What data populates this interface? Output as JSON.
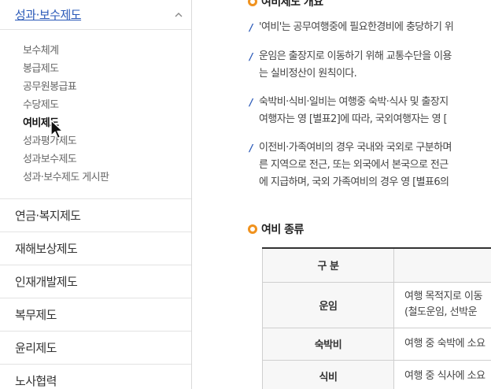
{
  "sidebar": {
    "title": "성과·보수제도",
    "sub_items": [
      {
        "label": "보수체계"
      },
      {
        "label": "봉급제도"
      },
      {
        "label": "공무원봉급표"
      },
      {
        "label": "수당제도"
      },
      {
        "label": "여비제도",
        "active": true
      },
      {
        "label": "성과평가제도"
      },
      {
        "label": "성과보수제도"
      },
      {
        "label": "성과·보수제도 게시판"
      }
    ],
    "top_items": [
      {
        "label": "연금·복지제도"
      },
      {
        "label": "재해보상제도"
      },
      {
        "label": "인재개발제도"
      },
      {
        "label": "복무제도"
      },
      {
        "label": "윤리제도"
      },
      {
        "label": "노사협력"
      }
    ]
  },
  "main": {
    "section1_title": "여비제도 개요",
    "paragraphs": [
      {
        "lines": [
          "'여비'는 공무여행중에 필요한경비에 충당하기 위"
        ]
      },
      {
        "lines": [
          "운임은 출장지로 이동하기 위해 교통수단을 이용",
          "는 실비정산이 원칙이다."
        ]
      },
      {
        "lines": [
          "숙박비·식비·일비는 여행중 숙박·식사 및 출장지",
          "여행자는 영 [별표2]에 따라, 국외여행자는 영 ["
        ]
      },
      {
        "lines": [
          "이전비·가족여비의 경우 국내와 국외로 구분하며",
          "른 지역으로 전근, 또는 외국에서 본국으로 전근",
          "에 지급하며, 국외 가족여비의 경우 영 [별표6의"
        ]
      }
    ],
    "section2_title": "여비 종류",
    "table": {
      "header": "구 분",
      "rows": [
        {
          "label": "운임",
          "lines": [
            "여행 목적지로 이동",
            "(철도운임, 선박운"
          ]
        },
        {
          "label": "숙박비",
          "lines": [
            "여행 중 숙박에 소요"
          ]
        },
        {
          "label": "식비",
          "lines": [
            "여행 중 식사에 소요"
          ]
        }
      ]
    }
  }
}
